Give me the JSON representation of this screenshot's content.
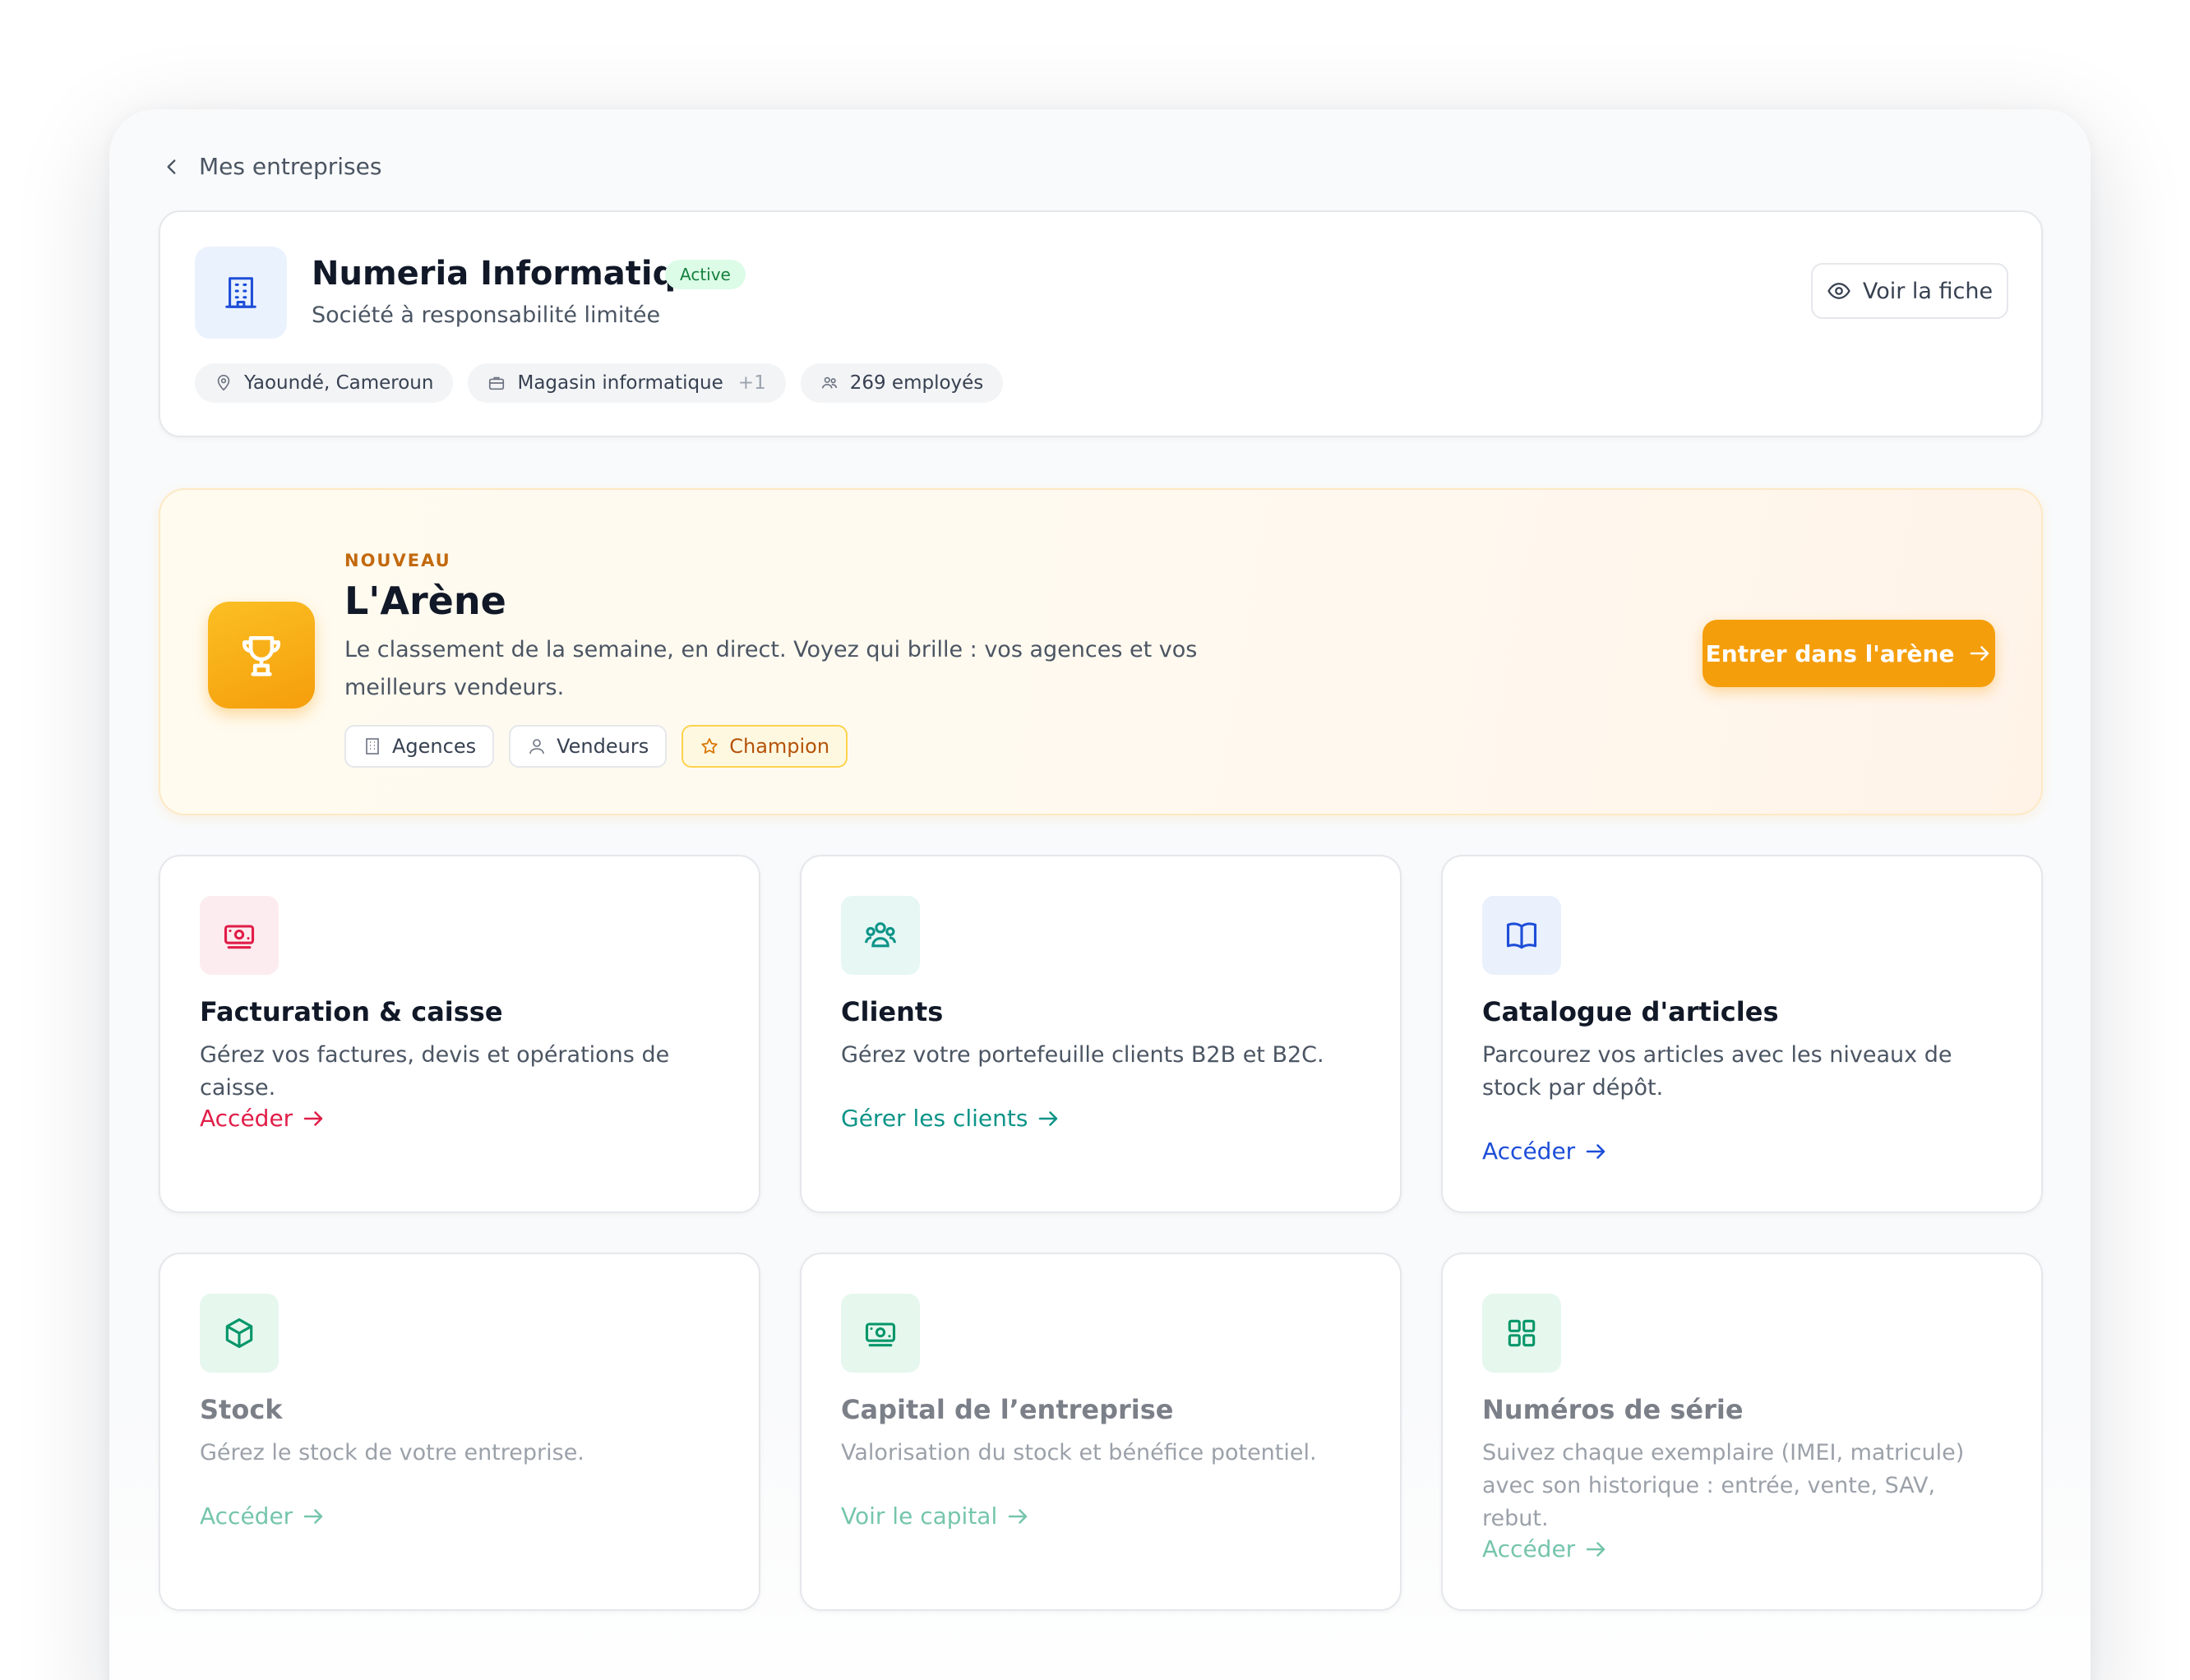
{
  "nav": {
    "back_label": "Mes entreprises"
  },
  "company": {
    "name": "Numeria Informatique",
    "status": "Active",
    "type": "Société à responsabilité limitée",
    "location": "Yaoundé, Cameroun",
    "sector": "Magasin informatique",
    "sector_extra": "+1",
    "employees": "269 employés",
    "view_button": "Voir la fiche"
  },
  "arena": {
    "tag": "NOUVEAU",
    "title": "L'Arène",
    "description": "Le classement de la semaine, en direct. Voyez qui brille : vos agences et vos meilleurs vendeurs.",
    "chips": [
      "Agences",
      "Vendeurs",
      "Champion"
    ],
    "cta": "Entrer dans l'arène",
    "accent": "#f59e0b"
  },
  "modules": [
    {
      "title": "Facturation & caisse",
      "description": "Gérez vos factures, devis et opérations de caisse.",
      "link": "Accéder",
      "icon": "cash-register-icon",
      "color": "#e11d48",
      "bg": "#fdecef"
    },
    {
      "title": "Clients",
      "description": "Gérez votre portefeuille clients B2B et B2C.",
      "link": "Gérer les clients",
      "icon": "users-icon",
      "color": "#0d9488",
      "bg": "#e6f7f4"
    },
    {
      "title": "Catalogue d'articles",
      "description": "Parcourez vos articles avec les niveaux de stock par dépôt.",
      "link": "Accéder",
      "icon": "book-icon",
      "color": "#1d4ed8",
      "bg": "#eaf1fd"
    },
    {
      "title": "Stock",
      "description": "Gérez le stock de votre entreprise.",
      "link": "Accéder",
      "icon": "box-icon",
      "color": "#059669",
      "bg": "#e6f7ee"
    },
    {
      "title": "Capital de l’entreprise",
      "description": "Valorisation du stock et bénéfice potentiel.",
      "link": "Voir le capital",
      "icon": "banknote-icon",
      "color": "#059669",
      "bg": "#e6f7ee"
    },
    {
      "title": "Numéros de série",
      "description": "Suivez chaque exemplaire (IMEI, matricule) avec son historique : entrée, vente, SAV, rebut.",
      "link": "Accéder",
      "icon": "grid-icon",
      "color": "#059669",
      "bg": "#e6f7ee"
    }
  ]
}
